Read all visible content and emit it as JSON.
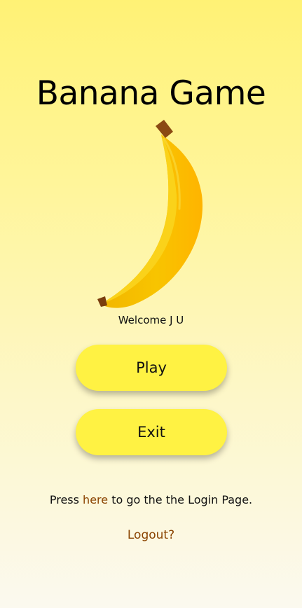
{
  "app": {
    "title": "Banana Game"
  },
  "hero": {
    "image_icon": "banana-icon",
    "welcome_text": "Welcome J U"
  },
  "buttons": {
    "play_label": "Play",
    "exit_label": "Exit"
  },
  "login_prompt": {
    "prefix": "Press ",
    "link_text": "here",
    "suffix": " to go the the Login Page."
  },
  "logout": {
    "label": "Logout?"
  },
  "colors": {
    "button_fill": "#fff243",
    "link": "#8a4300",
    "background_top": "#fff275",
    "background_bottom": "#fbf9ef"
  }
}
